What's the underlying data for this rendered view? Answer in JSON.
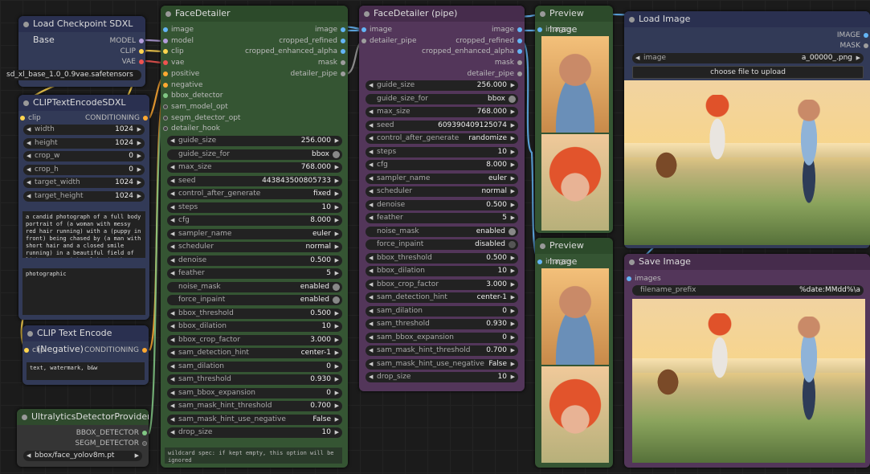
{
  "colors": {
    "image": "#64b5f6",
    "model": "#b39ddb",
    "clip": "#ffd54f",
    "vae": "#ef5350",
    "conditioning": "#ffa931",
    "detector": "#81c784",
    "mask": "#9e9e9e",
    "pipe": "#9e9e9e"
  },
  "load_checkpoint": {
    "title": "Load Checkpoint SDXL Base",
    "outputs": [
      "MODEL",
      "CLIP",
      "VAE"
    ],
    "ckpt_name": "sd_xl_base_1.0_0.9vae.safetensors"
  },
  "clip_sdxl": {
    "title": "CLIPTextEncodeSDXL",
    "input": "clip",
    "output": "CONDITIONING",
    "widgets": [
      {
        "label": "width",
        "value": "1024"
      },
      {
        "label": "height",
        "value": "1024"
      },
      {
        "label": "crop_w",
        "value": "0"
      },
      {
        "label": "crop_h",
        "value": "0"
      },
      {
        "label": "target_width",
        "value": "1024"
      },
      {
        "label": "target_height",
        "value": "1024"
      }
    ],
    "text_g": "a candid photograph of a full body portrait of (a woman with messy red hair running) with a (puppy in front) being chased by (a man with short hair and a closed smile running) in a beautiful field of light grass with a lake in the background at sunrise.",
    "text_l": "photographic"
  },
  "clip_neg": {
    "title": "CLIP Text Encode (Negative)",
    "input": "clip",
    "output": "CONDITIONING",
    "text": "text, watermark, b&w"
  },
  "ultralytics": {
    "title": "UltralyticsDetectorProvider",
    "outputs": [
      "BBOX_DETECTOR",
      "SEGM_DETECTOR"
    ],
    "model_name": "bbox/face_yolov8m.pt"
  },
  "face_detailer": {
    "title": "FaceDetailer",
    "inputs": [
      "image",
      "model",
      "clip",
      "vae",
      "positive",
      "negative",
      "bbox_detector",
      "sam_model_opt",
      "segm_detector_opt",
      "detailer_hook"
    ],
    "outputs": [
      "image",
      "cropped_refined",
      "cropped_enhanced_alpha",
      "mask",
      "detailer_pipe"
    ],
    "widgets": [
      {
        "label": "guide_size",
        "value": "256.000",
        "kind": "num"
      },
      {
        "label": "guide_size_for",
        "value": "bbox",
        "kind": "toggle"
      },
      {
        "label": "max_size",
        "value": "768.000",
        "kind": "num"
      },
      {
        "label": "seed",
        "value": "443843500805733",
        "kind": "num"
      },
      {
        "label": "control_after_generate",
        "value": "fixed",
        "kind": "num"
      },
      {
        "label": "steps",
        "value": "10",
        "kind": "num"
      },
      {
        "label": "cfg",
        "value": "8.000",
        "kind": "num"
      },
      {
        "label": "sampler_name",
        "value": "euler",
        "kind": "num"
      },
      {
        "label": "scheduler",
        "value": "normal",
        "kind": "num"
      },
      {
        "label": "denoise",
        "value": "0.500",
        "kind": "num"
      },
      {
        "label": "feather",
        "value": "5",
        "kind": "num"
      },
      {
        "label": "noise_mask",
        "value": "enabled",
        "kind": "toggle"
      },
      {
        "label": "force_inpaint",
        "value": "enabled",
        "kind": "toggle"
      },
      {
        "label": "bbox_threshold",
        "value": "0.500",
        "kind": "num"
      },
      {
        "label": "bbox_dilation",
        "value": "10",
        "kind": "num"
      },
      {
        "label": "bbox_crop_factor",
        "value": "3.000",
        "kind": "num"
      },
      {
        "label": "sam_detection_hint",
        "value": "center-1",
        "kind": "num"
      },
      {
        "label": "sam_dilation",
        "value": "0",
        "kind": "num"
      },
      {
        "label": "sam_threshold",
        "value": "0.930",
        "kind": "num"
      },
      {
        "label": "sam_bbox_expansion",
        "value": "0",
        "kind": "num"
      },
      {
        "label": "sam_mask_hint_threshold",
        "value": "0.700",
        "kind": "num"
      },
      {
        "label": "sam_mask_hint_use_negative",
        "value": "False",
        "kind": "num"
      },
      {
        "label": "drop_size",
        "value": "10",
        "kind": "num"
      }
    ],
    "wildcard": "wildcard spec: if kept empty, this option will be ignored"
  },
  "face_detailer_pipe": {
    "title": "FaceDetailer (pipe)",
    "inputs": [
      "image",
      "detailer_pipe"
    ],
    "outputs": [
      "image",
      "cropped_refined",
      "cropped_enhanced_alpha",
      "mask",
      "detailer_pipe"
    ],
    "widgets": [
      {
        "label": "guide_size",
        "value": "256.000",
        "kind": "num"
      },
      {
        "label": "guide_size_for",
        "value": "bbox",
        "kind": "toggle"
      },
      {
        "label": "max_size",
        "value": "768.000",
        "kind": "num"
      },
      {
        "label": "seed",
        "value": "609390409125074",
        "kind": "num"
      },
      {
        "label": "control_after_generate",
        "value": "randomize",
        "kind": "num"
      },
      {
        "label": "steps",
        "value": "10",
        "kind": "num"
      },
      {
        "label": "cfg",
        "value": "8.000",
        "kind": "num"
      },
      {
        "label": "sampler_name",
        "value": "euler",
        "kind": "num"
      },
      {
        "label": "scheduler",
        "value": "normal",
        "kind": "num"
      },
      {
        "label": "denoise",
        "value": "0.500",
        "kind": "num"
      },
      {
        "label": "feather",
        "value": "5",
        "kind": "num"
      },
      {
        "label": "noise_mask",
        "value": "enabled",
        "kind": "toggle"
      },
      {
        "label": "force_inpaint",
        "value": "disabled",
        "kind": "toggle-off"
      },
      {
        "label": "bbox_threshold",
        "value": "0.500",
        "kind": "num"
      },
      {
        "label": "bbox_dilation",
        "value": "10",
        "kind": "num"
      },
      {
        "label": "bbox_crop_factor",
        "value": "3.000",
        "kind": "num"
      },
      {
        "label": "sam_detection_hint",
        "value": "center-1",
        "kind": "num"
      },
      {
        "label": "sam_dilation",
        "value": "0",
        "kind": "num"
      },
      {
        "label": "sam_threshold",
        "value": "0.930",
        "kind": "num"
      },
      {
        "label": "sam_bbox_expansion",
        "value": "0",
        "kind": "num"
      },
      {
        "label": "sam_mask_hint_threshold",
        "value": "0.700",
        "kind": "num"
      },
      {
        "label": "sam_mask_hint_use_negative",
        "value": "False",
        "kind": "num"
      },
      {
        "label": "drop_size",
        "value": "10",
        "kind": "num"
      }
    ]
  },
  "preview1": {
    "title": "Preview Image",
    "input": "images"
  },
  "preview2": {
    "title": "Preview Image",
    "input": "images"
  },
  "load_image": {
    "title": "Load Image",
    "outputs": [
      "IMAGE",
      "MASK"
    ],
    "image_label": "image",
    "image_value": "a_00000_.png",
    "upload_label": "choose file to upload"
  },
  "save_image": {
    "title": "Save Image",
    "input": "images",
    "prefix_label": "filename_prefix",
    "prefix_value": "%date:MMdd%\\a"
  }
}
